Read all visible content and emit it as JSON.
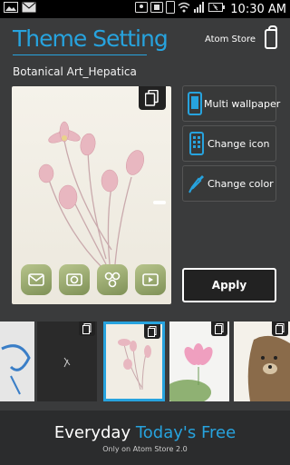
{
  "status_bar": {
    "time": "10:30 AM",
    "icons": [
      "image-icon",
      "mail-icon",
      "contacts-icon",
      "screen-icon",
      "phone-icon",
      "wifi-icon",
      "signal-icon",
      "battery-icon"
    ]
  },
  "header": {
    "title": "Theme Setting",
    "store_label": "Atom Store",
    "accent_color": "#27a3de"
  },
  "theme_name": "Botanical Art_Hepatica",
  "preview": {
    "dock_icons": [
      "mail-icon",
      "camera-icon",
      "gallery-icon",
      "video-icon"
    ]
  },
  "actions": {
    "multi_wallpaper": "Multi wallpaper",
    "change_icon": "Change icon",
    "change_color": "Change color",
    "apply": "Apply"
  },
  "thumbnails": [
    {
      "name": "blue-ink-theme",
      "selected": false
    },
    {
      "name": "dark-chalk-theme",
      "selected": false
    },
    {
      "name": "botanical-hepatica-theme",
      "selected": true
    },
    {
      "name": "lotus-theme",
      "selected": false
    },
    {
      "name": "bear-theme",
      "selected": false
    }
  ],
  "banner": {
    "main_prefix": "Everyday",
    "main_highlight": "Today's Free",
    "sub": "Only on Atom Store 2.0"
  }
}
